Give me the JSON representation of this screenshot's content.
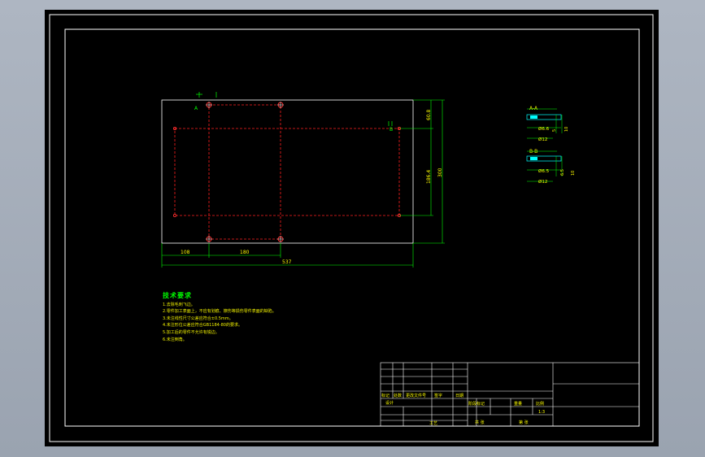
{
  "plate": {
    "dims": {
      "x_offset": "108",
      "x_spacing": "180",
      "x_total": "537",
      "y_top": "60.8",
      "y_spacing": "186.4",
      "y_total": "300"
    },
    "section_marks": {
      "a": "A",
      "b": "B"
    }
  },
  "sections": {
    "a_title": "A-A",
    "a_dia_small": "Ø6.6",
    "a_dia_large": "Ø12",
    "a_depth": "10",
    "a_thk": "5",
    "b_title": "B-B",
    "b_dia_small": "Ø6.5",
    "b_dia_large": "Ø12",
    "b_depth": "6.5",
    "b_thk": "10"
  },
  "notes": {
    "heading": "技术要求",
    "items": [
      "1.去除毛刺飞边。",
      "2.零件加工表面上，不应有划痕、擦伤等损伤零件表面的缺陷。",
      "3.未注线性尺寸公差应符合±0.5mm。",
      "4.未注形位公差应符合GB1184-80的要求。",
      "5.加工后的零件不允许有锐边。",
      "6.未注倒角。"
    ]
  },
  "title_block": {
    "rev_cells": [
      "标记",
      "处数",
      "更改文件号",
      "签字",
      "日期"
    ],
    "designer": "设计",
    "stage_mark": "阶段标记",
    "weight": "重量",
    "ratio": "比例",
    "ratio_value": "1:3",
    "approve": "审核",
    "sheet_total": "共 张",
    "sheet_no": "第 张",
    "process": "工艺",
    "date": "日期"
  }
}
